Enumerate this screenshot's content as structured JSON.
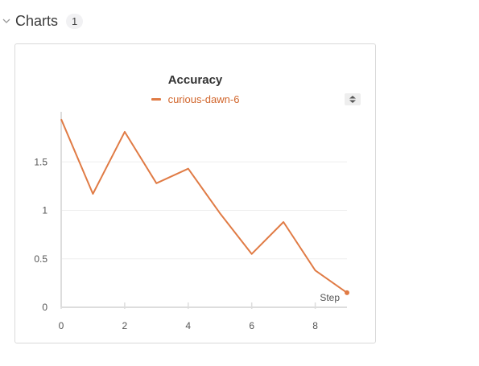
{
  "section": {
    "title": "Charts",
    "count": "1",
    "chevron_icon": "chevron-down-icon"
  },
  "panel": {
    "sort_icon": "sort-toggle-icon"
  },
  "colors": {
    "series": "#e07b45",
    "legend_text": "#d1652b",
    "grid": "#eeeeee",
    "axis": "#dddddd"
  },
  "chart_data": {
    "type": "line",
    "title": "Accuracy",
    "xlabel": "Step",
    "ylabel": "",
    "xlim": [
      0,
      9
    ],
    "ylim": [
      0,
      2.0
    ],
    "x_ticks": [
      "0",
      "2",
      "4",
      "6",
      "8"
    ],
    "y_ticks": [
      "0",
      "0.5",
      "1",
      "1.5"
    ],
    "grid": true,
    "legend": "top-center",
    "series": [
      {
        "name": "curious-dawn-6",
        "x": [
          0,
          1,
          2,
          3,
          4,
          5,
          6,
          7,
          8,
          9
        ],
        "values": [
          1.94,
          1.17,
          1.81,
          1.28,
          1.43,
          0.97,
          0.55,
          0.88,
          0.38,
          0.15
        ]
      }
    ]
  }
}
